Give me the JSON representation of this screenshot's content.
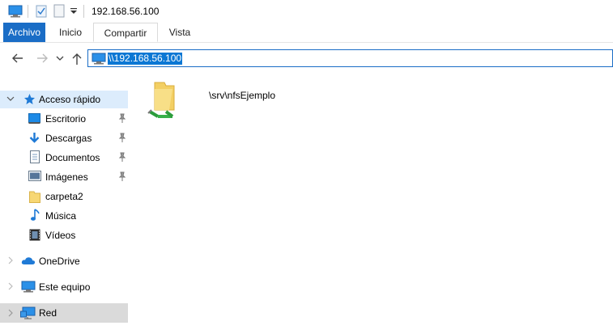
{
  "window": {
    "title": "192.168.56.100"
  },
  "ribbon": {
    "tabs": [
      "Archivo",
      "Inicio",
      "Compartir",
      "Vista"
    ]
  },
  "address": {
    "path": "\\\\192.168.56.100"
  },
  "navpane": {
    "quick_access": "Acceso rápido",
    "items": [
      "Escritorio",
      "Descargas",
      "Documentos",
      "Imágenes",
      "carpeta2",
      "Música",
      "Vídeos"
    ],
    "onedrive": "OneDrive",
    "thispc": "Este equipo",
    "network": "Red"
  },
  "content": {
    "items": [
      {
        "label": "\\srv\\nfsEjemplo",
        "icon": "network-share-folder-icon"
      }
    ]
  },
  "colors": {
    "accent": "#1a6dc6",
    "selection": "#0b77d4",
    "quick_access_bg": "#dcecfc",
    "network_bg": "#dadada"
  }
}
